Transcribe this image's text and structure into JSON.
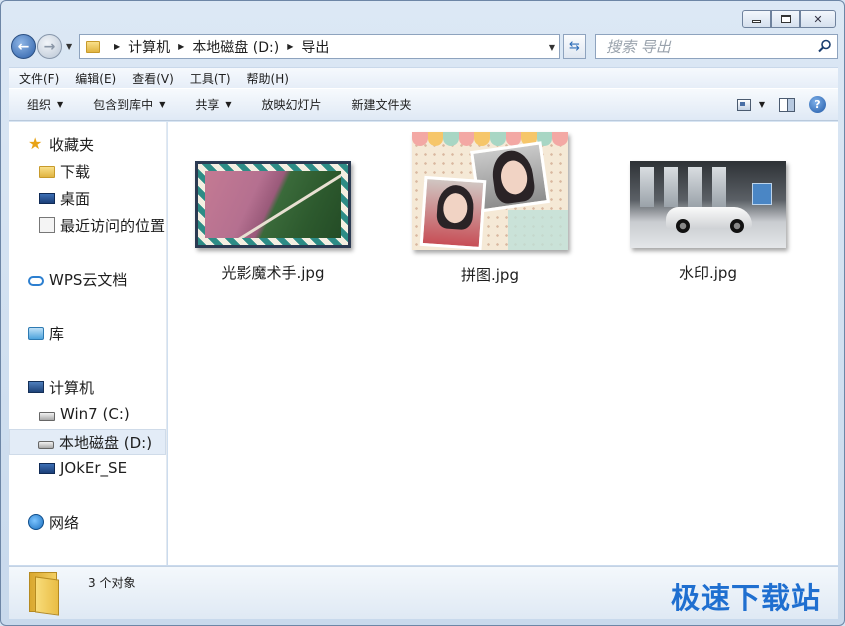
{
  "window": {
    "caption": {
      "minimize": "",
      "maximize": "",
      "close": "✕"
    }
  },
  "nav": {
    "back_icon": "back-arrow-icon",
    "forward_icon": "forward-arrow-icon",
    "breadcrumb": [
      "计算机",
      "本地磁盘 (D:)",
      "导出"
    ],
    "search_placeholder": "搜索 导出"
  },
  "menubar": {
    "items": [
      "文件(F)",
      "编辑(E)",
      "查看(V)",
      "工具(T)",
      "帮助(H)"
    ]
  },
  "commandbar": {
    "items": [
      {
        "label": "组织",
        "dropdown": true
      },
      {
        "label": "包含到库中",
        "dropdown": true
      },
      {
        "label": "共享",
        "dropdown": true
      },
      {
        "label": "放映幻灯片",
        "dropdown": false
      },
      {
        "label": "新建文件夹",
        "dropdown": false
      }
    ],
    "help": "?"
  },
  "navpane": {
    "favorites": {
      "label": "收藏夹",
      "items": [
        "下载",
        "桌面",
        "最近访问的位置"
      ]
    },
    "wps": "WPS云文档",
    "libraries": "库",
    "computer": {
      "label": "计算机",
      "items": [
        "Win7 (C:)",
        "本地磁盘 (D:)",
        "JOkEr_SE"
      ],
      "selected": "本地磁盘 (D:)"
    },
    "network": "网络"
  },
  "files": [
    {
      "name": "光影魔术手.jpg"
    },
    {
      "name": "拼图.jpg"
    },
    {
      "name": "水印.jpg"
    }
  ],
  "details": {
    "count": "3 个对象"
  },
  "watermark": "极速下载站",
  "colors": {
    "accent": "#1f6fd0",
    "selection": "#e3ecf7"
  }
}
